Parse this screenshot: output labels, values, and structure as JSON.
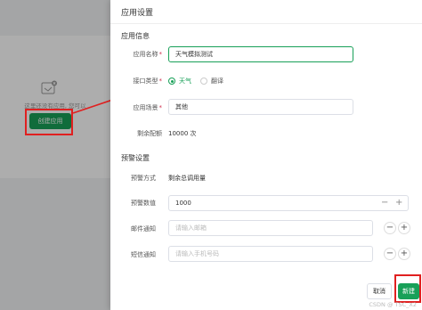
{
  "background": {
    "empty_text": "这里还没有应用, 您可以",
    "create_button": "创建应用"
  },
  "drawer": {
    "title": "应用设置",
    "app_info": {
      "section_title": "应用信息",
      "name_label": "应用名称",
      "name_value": "天气模拟测试",
      "interface_label": "接口类型",
      "interface_options": [
        "天气",
        "翻译"
      ],
      "interface_selected": "天气",
      "scene_label": "应用场景",
      "scene_value": "其他",
      "quota_label": "剩余配额",
      "quota_value": "10000 次"
    },
    "alert": {
      "section_title": "预警设置",
      "method_label": "预警方式",
      "method_value": "剩余总调用量",
      "threshold_label": "预警数值",
      "threshold_value": "1000",
      "email_label": "邮件通知",
      "email_placeholder": "请输入邮箱",
      "sms_label": "短信通知",
      "sms_placeholder": "请输入手机号码"
    },
    "footer": {
      "cancel_label": "取消",
      "create_label": "新建"
    }
  },
  "watermark": "CSDN @ TSC_X2",
  "colors": {
    "accent": "#18a058",
    "highlight": "#e02020",
    "required": "#d03050"
  }
}
